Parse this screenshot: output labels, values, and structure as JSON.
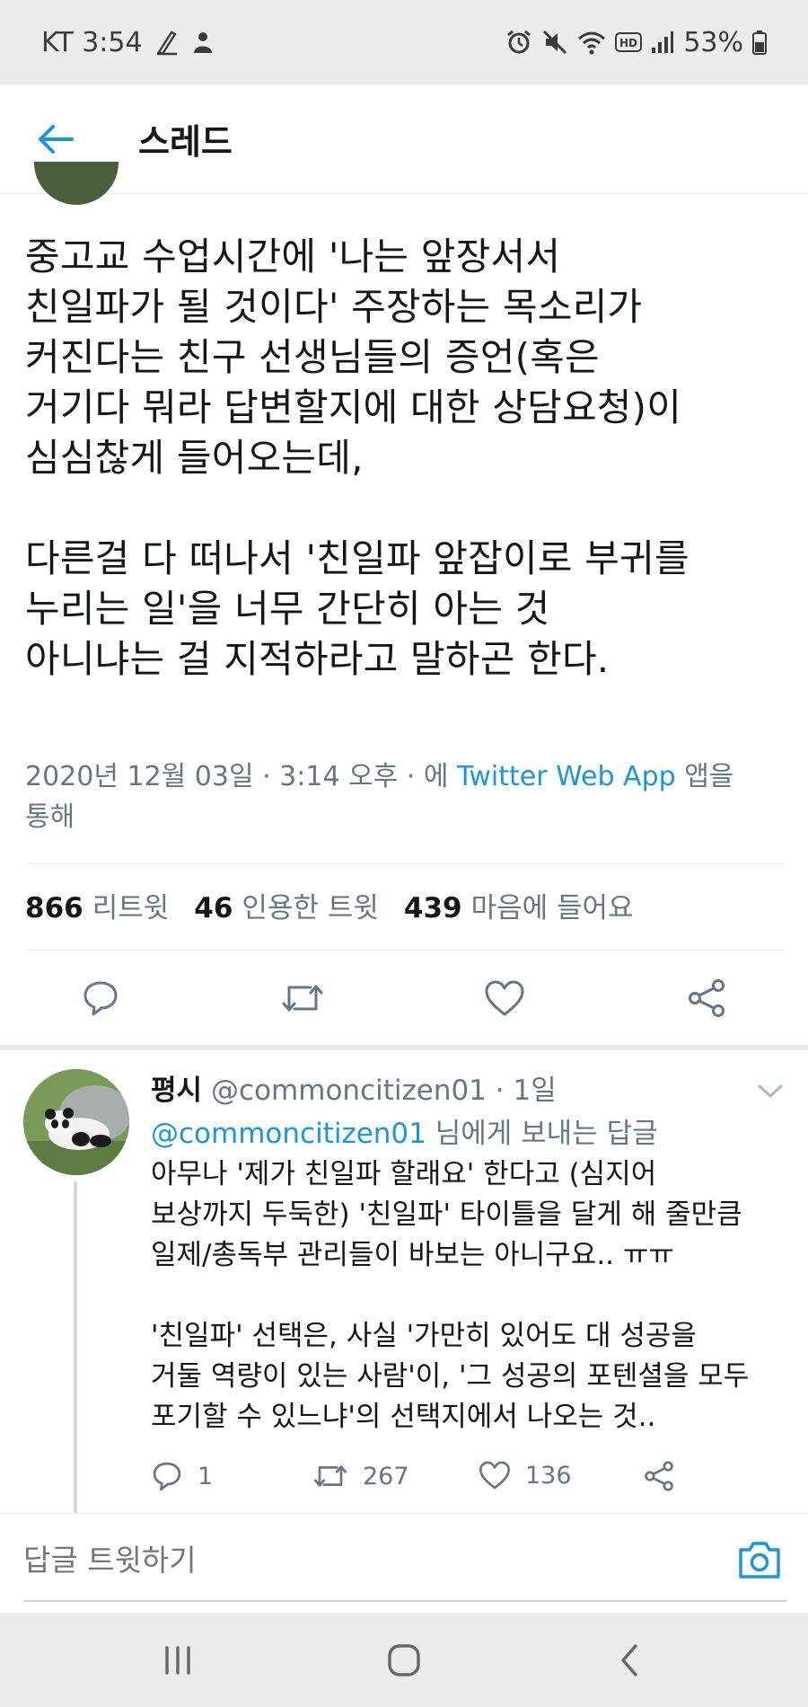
{
  "status_bar": {
    "carrier_time": "KT 3:54",
    "battery": "53%"
  },
  "header": {
    "title": "스레드"
  },
  "main_tweet": {
    "text": "중고교 수업시간에 '나는 앞장서서\n친일파가 될 것이다' 주장하는 목소리가\n커진다는 친구 선생님들의 증언(혹은\n거기다 뭐라 답변할지에 대한 상담요청)이\n심심찮게 들어오는데,\n\n다른걸 다 떠나서 '친일파 앞잡이로 부귀를\n누리는 일'을 너무 간단히 아는 것\n아니냐는 걸 지적하라고 말하곤 한다.",
    "meta_prefix": "2020년 12월 03일 · 3:14 오후 · 에 ",
    "meta_link": "Twitter Web App",
    "meta_suffix": " 앱을\n통해"
  },
  "stats": {
    "retweets_count": "866",
    "retweets_label": "리트윗",
    "quotes_count": "46",
    "quotes_label": "인용한 트윗",
    "likes_count": "439",
    "likes_label": "마음에 들어요"
  },
  "reply": {
    "name": "평시",
    "handle_time": "@commoncitizen01 · 1일",
    "reply_to_link": "@commoncitizen01",
    "reply_to_suffix": " 님에게 보내는 답글",
    "text": "아무나 '제가 친일파 할래요' 한다고 (심지어\n보상까지 두둑한) '친일파' 타이틀을 달게 해 줄만큼\n일제/총독부 관리들이 바보는 아니구요.. ㅠㅠ\n\n'친일파' 선택은, 사실 '가만히 있어도 대 성공을\n거둘 역량이 있는 사람'이, '그 성공의 포텐셜을 모두\n포기할 수 있느냐'의 선택지에서 나오는 것..",
    "reply_count": "1",
    "retweet_count": "267",
    "like_count": "136"
  },
  "compose": {
    "placeholder": "답글 트윗하기"
  },
  "colors": {
    "accent": "#1b95e0",
    "secondary_text": "#657786",
    "primary_text": "#14171a"
  }
}
